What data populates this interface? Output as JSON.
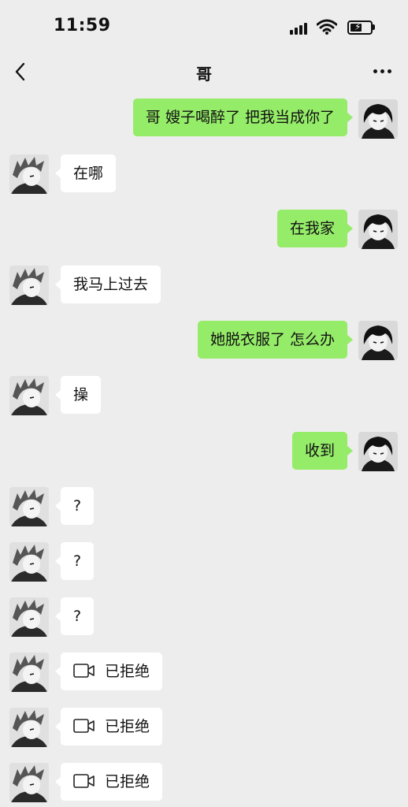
{
  "status_bar": {
    "time": "11:59"
  },
  "nav": {
    "title": "哥"
  },
  "messages": [
    {
      "side": "out",
      "text": "哥 嫂子喝醉了 把我当成你了"
    },
    {
      "side": "in",
      "text": "在哪"
    },
    {
      "side": "out",
      "text": "在我家"
    },
    {
      "side": "in",
      "text": "我马上过去"
    },
    {
      "side": "out",
      "text": "她脱衣服了 怎么办"
    },
    {
      "side": "in",
      "text": "操"
    },
    {
      "side": "out",
      "text": "收到"
    },
    {
      "side": "in",
      "text": "?"
    },
    {
      "side": "in",
      "text": "?"
    },
    {
      "side": "in",
      "text": "?"
    },
    {
      "side": "in",
      "type": "video-call",
      "icon": "video-call-icon",
      "text": "已拒绝"
    },
    {
      "side": "in",
      "type": "video-call",
      "icon": "video-call-icon",
      "text": "已拒绝"
    },
    {
      "side": "in",
      "type": "video-call",
      "icon": "video-call-icon",
      "text": "已拒绝"
    }
  ],
  "colors": {
    "background": "#ededed",
    "outgoing_bubble": "#95ec69",
    "incoming_bubble": "#ffffff"
  }
}
